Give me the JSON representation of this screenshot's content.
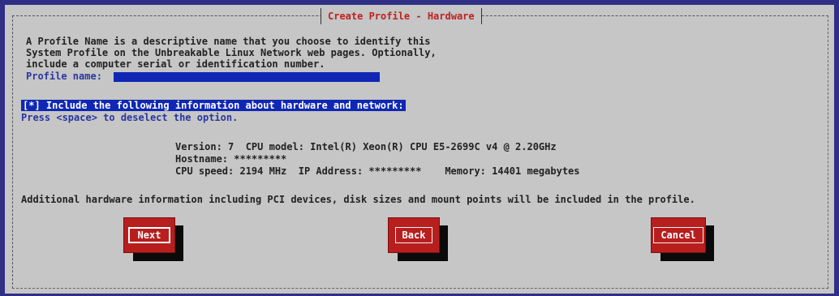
{
  "dialog": {
    "title": "Create Profile - Hardware",
    "intro_line1": "A Profile Name is a descriptive name that you choose to identify this",
    "intro_line2": "System Profile on the Unbreakable Linux Network web pages. Optionally,",
    "intro_line3": "include a computer serial or identification number.",
    "profile_label": "Profile name:",
    "profile_value": "",
    "checkbox_label": "[*] Include the following information about hardware and network:",
    "checkbox_help": "Press <space> to deselect the option.",
    "info_line1": "Version: 7  CPU model: Intel(R) Xeon(R) CPU E5-2699C v4 @ 2.20GHz",
    "info_line2": "Hostname: *********",
    "info_line3": "CPU speed: 2194 MHz  IP Address: *********    Memory: 14401 megabytes",
    "additional": "Additional hardware information including PCI devices, disk sizes and mount points will be included in the profile."
  },
  "buttons": {
    "next": "Next",
    "back": "Back",
    "cancel": "Cancel"
  },
  "colors": {
    "background": "#2f2f86",
    "dialog": "#c6c6c6",
    "highlight": "#0f27b4",
    "button": "#b81e1e",
    "title": "#c02020"
  }
}
